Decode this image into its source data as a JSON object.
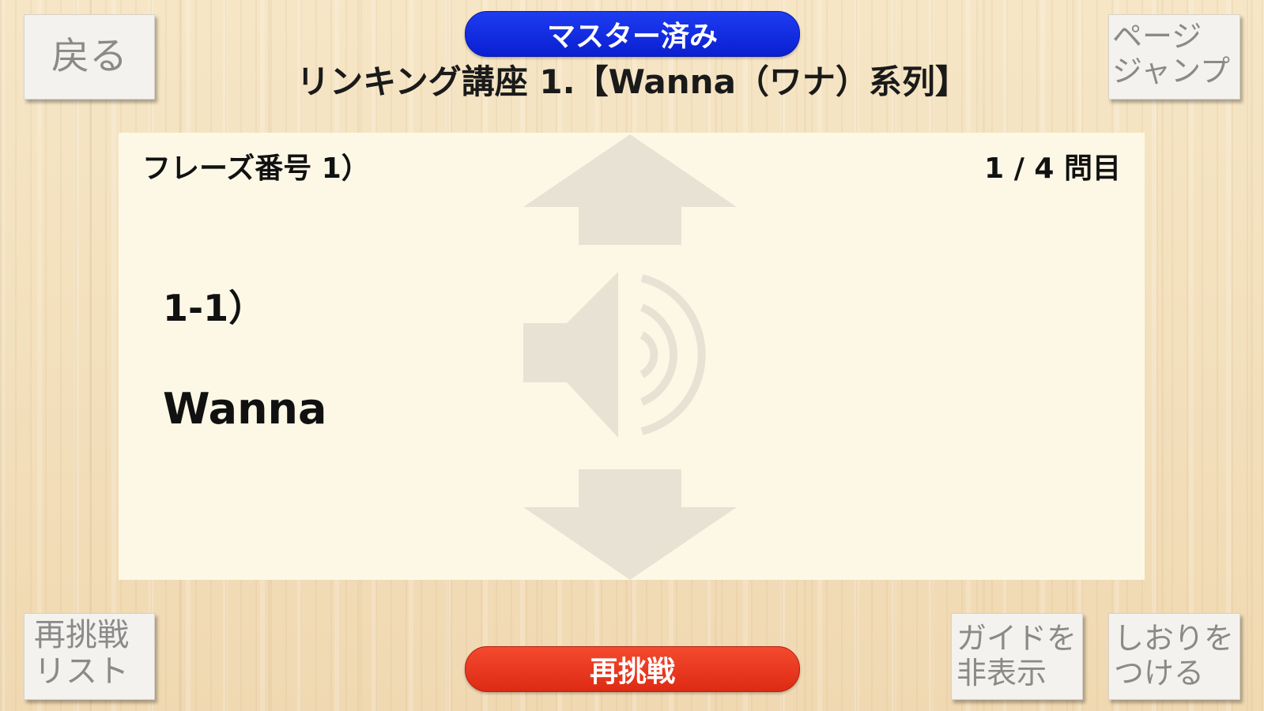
{
  "header": {
    "back_label": "戻る",
    "mastered_label": "マスター済み",
    "lesson_title": "リンキング講座 1.【Wanna（ワナ）系列】",
    "page_jump_line1": "ページ",
    "page_jump_line2": "ジャンプ"
  },
  "card": {
    "phrase_label": "フレーズ番号 1）",
    "progress_label": "1 / 4 問目",
    "item_number": "1-1）",
    "phrase_text": "Wanna"
  },
  "footer": {
    "retry_list_line1": "再挑戦",
    "retry_list_line2": "リスト",
    "retry_label": "再挑戦",
    "guide_line1": "ガイドを",
    "guide_line2": "非表示",
    "bookmark_line1": "しおりを",
    "bookmark_line2": "つける"
  },
  "colors": {
    "mastered_blue": "#0a1fd0",
    "retry_red": "#de2a14",
    "card_bg": "#fdf8e6",
    "guide_gray": "#e8e2d4"
  },
  "icons": {
    "up": "arrow-up-icon",
    "speaker": "speaker-icon",
    "down": "arrow-down-icon"
  }
}
